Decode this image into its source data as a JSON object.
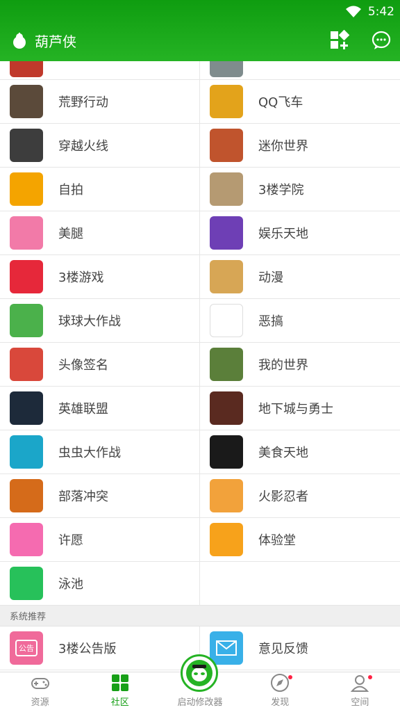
{
  "status": {
    "time": "5:42"
  },
  "header": {
    "title": "葫芦侠"
  },
  "grid": {
    "rows": [
      {
        "left": {
          "label": "",
          "icon": "game-thumb",
          "color": "#c0392b"
        },
        "right": {
          "label": "",
          "icon": "game-thumb",
          "color": "#7f8c8d"
        }
      },
      {
        "left": {
          "label": "荒野行动",
          "icon": "game-thumb",
          "color": "#5b4a3a"
        },
        "right": {
          "label": "QQ飞车",
          "icon": "game-thumb",
          "color": "#e3a31b"
        }
      },
      {
        "left": {
          "label": "穿越火线",
          "icon": "game-thumb",
          "color": "#3d3d3d"
        },
        "right": {
          "label": "迷你世界",
          "icon": "game-thumb",
          "color": "#c0542d"
        }
      },
      {
        "left": {
          "label": "自拍",
          "icon": "camera-icon",
          "color": "#f4a400"
        },
        "right": {
          "label": "3楼学院",
          "icon": "book-thumb",
          "color": "#b59a72"
        }
      },
      {
        "left": {
          "label": "美腿",
          "icon": "legs-icon",
          "color": "#f27aa8"
        },
        "right": {
          "label": "娱乐天地",
          "icon": "star-icon",
          "color": "#6e3fb5"
        }
      },
      {
        "left": {
          "label": "3楼游戏",
          "icon": "gameboy-icon",
          "color": "#e6283a"
        },
        "right": {
          "label": "动漫",
          "icon": "anime-thumb",
          "color": "#d7a655"
        }
      },
      {
        "left": {
          "label": "球球大作战",
          "icon": "game-thumb",
          "color": "#4bb14b"
        },
        "right": {
          "label": "恶搞",
          "icon": "meme-thumb",
          "color": "#ffffff"
        }
      },
      {
        "left": {
          "label": "头像签名",
          "icon": "avatar-thumb",
          "color": "#d9483b"
        },
        "right": {
          "label": "我的世界",
          "icon": "game-thumb",
          "color": "#5b7f3a"
        }
      },
      {
        "left": {
          "label": "英雄联盟",
          "icon": "game-thumb",
          "color": "#1d2a3a"
        },
        "right": {
          "label": "地下城与勇士",
          "icon": "game-thumb",
          "color": "#5a2a20"
        }
      },
      {
        "left": {
          "label": "虫虫大作战",
          "icon": "game-thumb",
          "color": "#1ba6c9"
        },
        "right": {
          "label": "美食天地",
          "icon": "food-thumb",
          "color": "#1a1a1a"
        }
      },
      {
        "left": {
          "label": "部落冲突",
          "icon": "game-thumb",
          "color": "#d56b1a"
        },
        "right": {
          "label": "火影忍者",
          "icon": "game-thumb",
          "color": "#f2a23b"
        }
      },
      {
        "left": {
          "label": "许愿",
          "icon": "heart-icon",
          "color": "#f56bb0"
        },
        "right": {
          "label": "体验堂",
          "icon": "gamepad-icon",
          "color": "#f7a21b"
        }
      },
      {
        "left": {
          "label": "泳池",
          "icon": "lifebuoy-icon",
          "color": "#27c15a"
        },
        "right": null
      }
    ]
  },
  "section": {
    "title": "系统推荐"
  },
  "recommended": {
    "left": {
      "label": "3楼公告版",
      "icon": "notice-icon",
      "color": "#f06a9a",
      "badge": "公告"
    },
    "right": {
      "label": "意见反馈",
      "icon": "mail-icon",
      "color": "#39b0e8"
    }
  },
  "nav": {
    "tabs": [
      {
        "label": "资源",
        "icon": "gamepad-icon"
      },
      {
        "label": "社区",
        "icon": "grid-icon"
      },
      {
        "label": "启动修改器",
        "icon": "launcher-icon"
      },
      {
        "label": "发现",
        "icon": "compass-icon"
      },
      {
        "label": "空间",
        "icon": "user-icon"
      }
    ],
    "active_color": "#18a018"
  }
}
